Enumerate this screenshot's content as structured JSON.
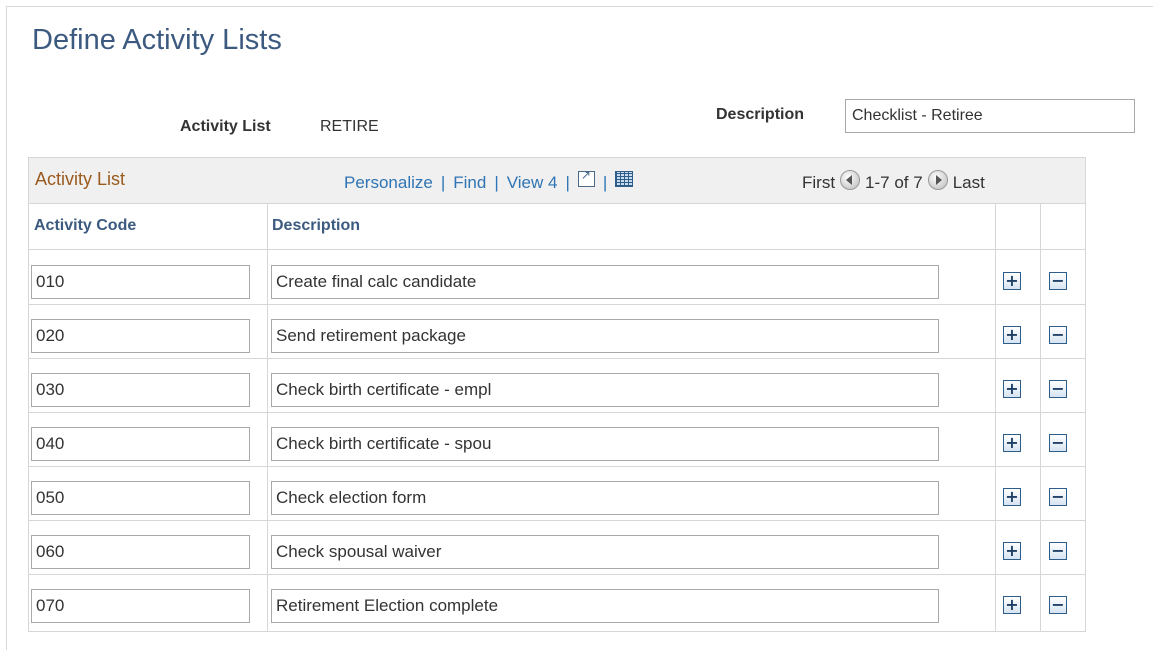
{
  "page": {
    "title": "Define Activity Lists"
  },
  "header": {
    "activity_list_label": "Activity List",
    "activity_list_value": "RETIRE",
    "description_label": "Description",
    "description_value": "Checklist - Retiree"
  },
  "grid": {
    "title": "Activity List",
    "nav": {
      "personalize": "Personalize",
      "find": "Find",
      "view4": "View 4",
      "separator": "|"
    },
    "pager": {
      "first": "First",
      "range": "1-7 of 7",
      "last": "Last"
    },
    "columns": {
      "code": "Activity Code",
      "description": "Description"
    },
    "rows": [
      {
        "code": "010",
        "description": "Create final calc candidate"
      },
      {
        "code": "020",
        "description": "Send retirement package"
      },
      {
        "code": "030",
        "description": "Check birth certificate - empl"
      },
      {
        "code": "040",
        "description": "Check birth certificate - spou"
      },
      {
        "code": "050",
        "description": "Check election form"
      },
      {
        "code": "060",
        "description": "Check spousal waiver"
      },
      {
        "code": "070",
        "description": "Retirement Election complete"
      }
    ],
    "add_symbol": "+",
    "delete_symbol": "−"
  },
  "colors": {
    "title": "#3c5a80",
    "link": "#2f74b5",
    "grid_title": "#9a5a1e",
    "header_bg": "#f0f0f0"
  },
  "icons": [
    "zoom-icon",
    "grid-icon",
    "previous-icon",
    "next-icon",
    "plus-icon",
    "minus-icon"
  ]
}
